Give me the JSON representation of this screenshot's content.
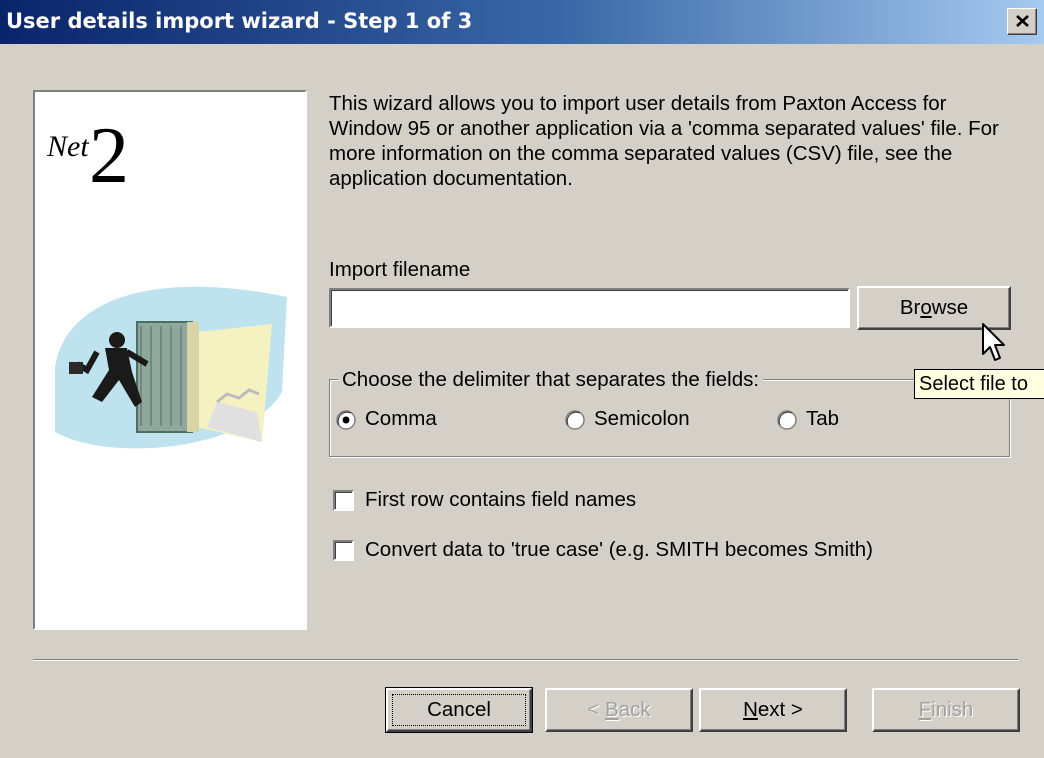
{
  "window": {
    "title": "User details import wizard - Step 1 of 3",
    "close_icon": "close-icon"
  },
  "side_panel": {
    "logo_prefix": "Net",
    "logo_digit": "2",
    "illustration_icon": "running-businessman-door-illustration"
  },
  "description": "This wizard allows you to import user details from Paxton Access for Window 95 or another application via a 'comma separated values' file. For more information on the comma separated values (CSV) file, see the application documentation.",
  "import": {
    "label": "Import filename",
    "value": "",
    "browse_label": "Browse",
    "browse_mnemonic": "o"
  },
  "delimiter": {
    "legend": "Choose the delimiter that separates the fields:",
    "options": [
      {
        "label": "Comma",
        "selected": true
      },
      {
        "label": "Semicolon",
        "selected": false
      },
      {
        "label": "Tab",
        "selected": false
      }
    ]
  },
  "options": {
    "first_row": {
      "label": "First row contains field names",
      "checked": false
    },
    "true_case": {
      "label": "Convert data to 'true case' (e.g. SMITH becomes Smith)",
      "checked": false
    }
  },
  "buttons": {
    "cancel": "Cancel",
    "back_prefix": "< ",
    "back_mnemonic": "B",
    "back_rest": "ack",
    "next_mnemonic": "N",
    "next_rest": "ext >",
    "finish_mnemonic": "F",
    "finish_rest": "inish"
  },
  "tooltip": "Select file to",
  "colors": {
    "title_gradient_start": "#0a246a",
    "title_gradient_end": "#a6caf0",
    "face": "#d4d0c8",
    "tooltip_bg": "#ffffe1"
  }
}
